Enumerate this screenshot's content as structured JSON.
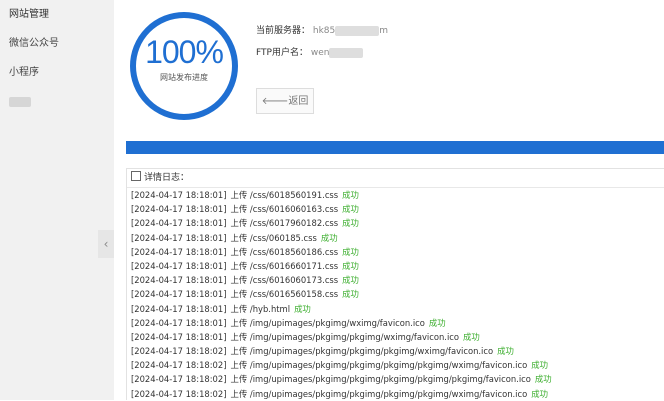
{
  "sidebar": {
    "items": [
      {
        "label": "网站管理"
      },
      {
        "label": "微信公众号"
      },
      {
        "label": "小程序"
      }
    ],
    "collapse_glyph": "‹"
  },
  "progress": {
    "percent_text": "100%",
    "caption": "网站发布进度",
    "fraction": 1.0
  },
  "server": {
    "label": "当前服务器：",
    "value_start": "hk85",
    "value_end": "m"
  },
  "ftp": {
    "label": "FTP用户名：",
    "value_start": "wen"
  },
  "back_button": {
    "label": "返回",
    "icon": "arrow-left-icon"
  },
  "log": {
    "title": "详情日志：",
    "action": "上传",
    "success": "成功",
    "entries": [
      {
        "time": "[2024-04-17 18:18:01]",
        "path": "/css/6018560191.css"
      },
      {
        "time": "[2024-04-17 18:18:01]",
        "path": "/css/6016060163.css"
      },
      {
        "time": "[2024-04-17 18:18:01]",
        "path": "/css/6017960182.css"
      },
      {
        "time": "[2024-04-17 18:18:01]",
        "path": "/css/060185.css"
      },
      {
        "time": "[2024-04-17 18:18:01]",
        "path": "/css/6018560186.css"
      },
      {
        "time": "[2024-04-17 18:18:01]",
        "path": "/css/6016660171.css"
      },
      {
        "time": "[2024-04-17 18:18:01]",
        "path": "/css/6016060173.css"
      },
      {
        "time": "[2024-04-17 18:18:01]",
        "path": "/css/6016560158.css"
      },
      {
        "time": "[2024-04-17 18:18:01]",
        "path": "/hyb.html"
      },
      {
        "time": "[2024-04-17 18:18:01]",
        "path": "/img/upimages/pkgimg/wximg/favicon.ico"
      },
      {
        "time": "[2024-04-17 18:18:01]",
        "path": "/img/upimages/pkgimg/pkgimg/wximg/favicon.ico"
      },
      {
        "time": "[2024-04-17 18:18:02]",
        "path": "/img/upimages/pkgimg/pkgimg/pkgimg/wximg/favicon.ico"
      },
      {
        "time": "[2024-04-17 18:18:02]",
        "path": "/img/upimages/pkgimg/pkgimg/pkgimg/pkgimg/wximg/favicon.ico"
      },
      {
        "time": "[2024-04-17 18:18:02]",
        "path": "/img/upimages/pkgimg/pkgimg/pkgimg/pkgimg/pkgimg/favicon.ico"
      },
      {
        "time": "[2024-04-17 18:18:02]",
        "path": "/img/upimages/pkgimg/pkgimg/pkgimg/pkgimg/wximg/favicon.ico"
      }
    ]
  },
  "colors": {
    "accent": "#1f6fd2",
    "success": "#3cae2e",
    "sidebar_bg": "#f1f1f1"
  }
}
